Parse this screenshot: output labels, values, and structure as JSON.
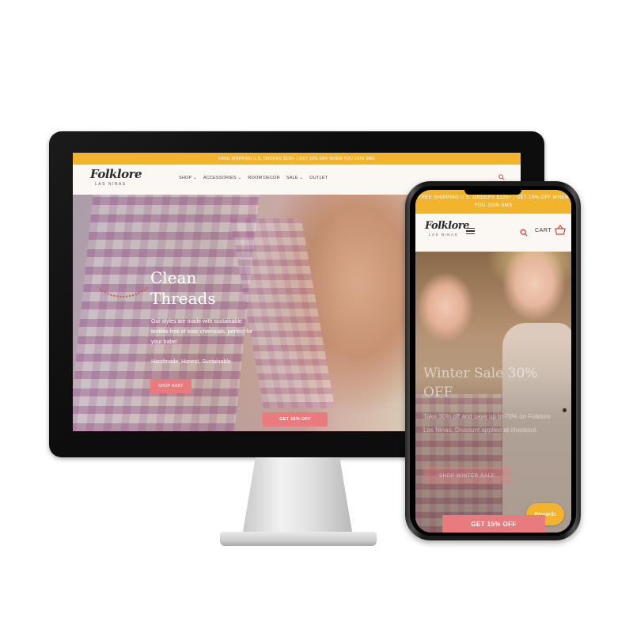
{
  "desktop": {
    "banner": "FREE SHIPPING U.S. ORDERS $125+ | GET 15% OFF WHEN YOU JOIN SMS",
    "logo": {
      "main": "Folklore",
      "sub": "LAS NINAS"
    },
    "nav": {
      "shop": "SHOP",
      "accessories": "ACCESSORIES",
      "room_decor": "ROOM DECOR",
      "sale": "SALE",
      "outlet": "OUTLET"
    },
    "hero": {
      "title": "Clean Threads",
      "body": "Our styles are made with sustainable textiles free of toxic chemicals, perfect for your babe!",
      "tagline": "Handmade. Honest. Sustainable",
      "shop_button": "SHOP BABY",
      "get_button": "GET 15% OFF"
    }
  },
  "mobile": {
    "banner": "FREE SHIPPING U.S. ORDERS $125+ | GET 15% OFF WHEN YOU JOIN SMS",
    "logo": {
      "main": "Folklore",
      "sub": "LAS NINAS"
    },
    "cart_label": "CART",
    "hero": {
      "title": "Winter Sale 30% OFF",
      "body": "Take 30% off and save up to 70% on Folklore Las Ninas. Discount applied at checkout.",
      "shop_button": "SHOP WINTER SALE",
      "get_button": "GET 15% OFF",
      "rewards_button": "Rewards"
    }
  },
  "colors": {
    "banner": "#f1b42c",
    "button": "#e97a7e",
    "background": "#fbf8f3"
  }
}
